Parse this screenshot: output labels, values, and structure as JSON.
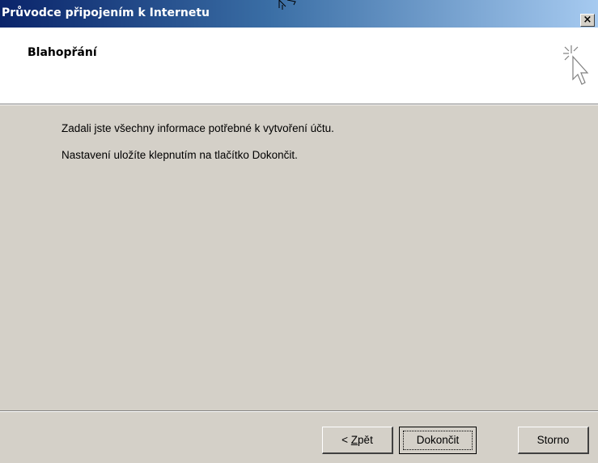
{
  "window": {
    "title": "Průvodce připojením k Internetu",
    "close_label": "×"
  },
  "header": {
    "heading": "Blahopřání",
    "icon": "wizard-cursor-sparkle-icon"
  },
  "content": {
    "line1": "Zadali jste všechny informace potřebné k vytvoření účtu.",
    "line2": "Nastavení uložíte klepnutím na tlačítko Dokončit."
  },
  "buttons": {
    "back_prefix": "< ",
    "back_mnemonic": "Z",
    "back_rest": "pět",
    "finish": "Dokončit",
    "cancel": "Storno"
  },
  "colors": {
    "title_start": "#0a246a",
    "title_end": "#a6caf0",
    "face": "#d4d0c8"
  }
}
